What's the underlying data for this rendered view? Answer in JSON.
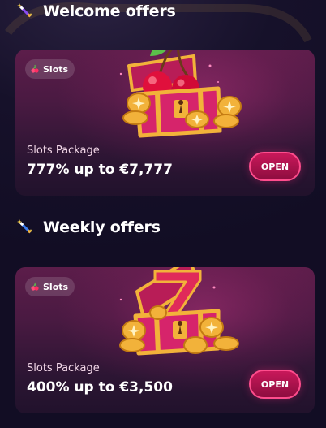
{
  "sections": [
    {
      "title": "Welcome offers",
      "icon": "magic-wand-icon",
      "card": {
        "badge": {
          "icon": "cherry-icon",
          "label": "Slots"
        },
        "illustration": "treasure-chest-cherries",
        "package_name": "Slots Package",
        "offer": "777% up to €7,777",
        "button_label": "OPEN"
      }
    },
    {
      "title": "Weekly offers",
      "icon": "magic-wand-icon",
      "card": {
        "badge": {
          "icon": "cherry-icon",
          "label": "Slots"
        },
        "illustration": "treasure-chest-seven",
        "package_name": "Slots Package",
        "offer": "400% up to €3,500",
        "button_label": "OPEN"
      }
    }
  ],
  "colors": {
    "background": "#15102a",
    "card_top": "#5c1d4a",
    "card_bottom": "#21122c",
    "button": "#c8185a",
    "button_border": "#ff4d8d",
    "gold": "#f2b23a",
    "chest_pink": "#d6246b"
  }
}
